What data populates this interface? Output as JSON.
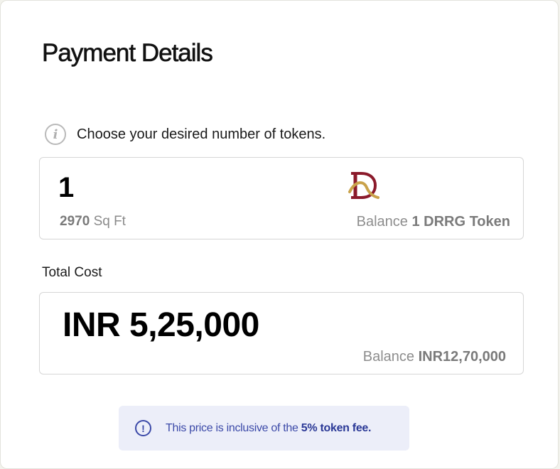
{
  "dialog": {
    "title": "Payment Details"
  },
  "tokens": {
    "hint": "Choose your desired number of tokens.",
    "quantity": "1",
    "area_value": "2970",
    "area_unit": "Sq Ft",
    "balance_label": "Balance",
    "balance_value": "1 DRRG Token"
  },
  "cost": {
    "label": "Total Cost",
    "amount": "INR 5,25,000",
    "balance_label": "Balance",
    "balance_value": "INR12,70,000"
  },
  "notice": {
    "text": "This price is inclusive of the",
    "highlight": "5% token fee."
  },
  "colors": {
    "accent": "#3b49a8",
    "notice_bg": "#eceef9",
    "logo_red": "#8b1a2b",
    "logo_gold": "#c9a24a"
  },
  "icons": {
    "hint": "info-icon",
    "notice": "alert-circle-icon",
    "brand": "drrg-logo"
  }
}
